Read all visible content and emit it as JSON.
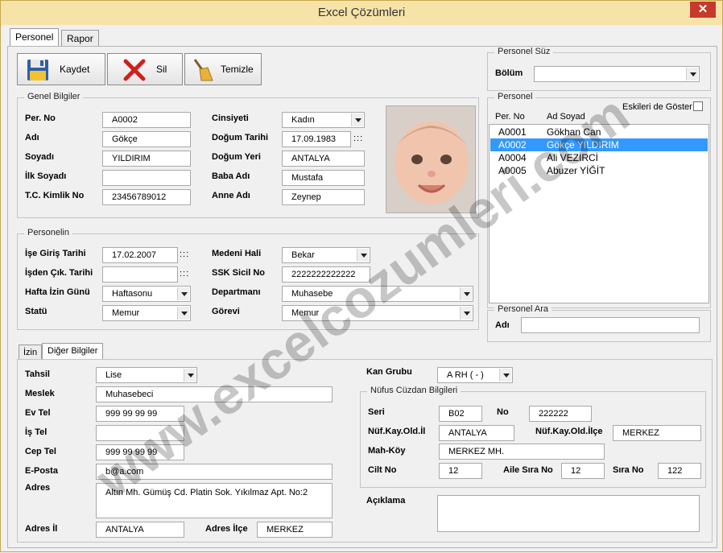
{
  "window": {
    "title": "Excel Çözümleri",
    "close_glyph": "✕"
  },
  "main_tabs": [
    {
      "label": "Personel"
    },
    {
      "label": "Rapor"
    }
  ],
  "toolbar": {
    "save_label": "Kaydet",
    "delete_label": "Sil",
    "clear_label": "Temizle"
  },
  "genel": {
    "legend": "Genel Bilgiler",
    "per_no": {
      "label": "Per. No",
      "value": "A0002"
    },
    "adi": {
      "label": "Adı",
      "value": "Gökçe"
    },
    "soyadi": {
      "label": "Soyadı",
      "value": "YILDIRIM"
    },
    "ilk_soyadi": {
      "label": "İlk Soyadı",
      "value": ""
    },
    "tc": {
      "label": "T.C. Kimlik No",
      "value": "23456789012"
    },
    "cinsiyet": {
      "label": "Cinsiyeti",
      "value": "Kadın"
    },
    "dogum_tarihi": {
      "label": "Doğum Tarihi",
      "value": "17.09.1983"
    },
    "dogum_yeri": {
      "label": "Doğum Yeri",
      "value": "ANTALYA"
    },
    "baba_adi": {
      "label": "Baba Adı",
      "value": "Mustafa"
    },
    "anne_adi": {
      "label": "Anne Adı",
      "value": "Zeynep"
    }
  },
  "personelin": {
    "legend": "Personelin",
    "ise_giris": {
      "label": "İşe Giriş Tarihi",
      "value": "17.02.2007"
    },
    "isden_cikis": {
      "label": "İşden Çık. Tarihi",
      "value": ""
    },
    "hafta_izin": {
      "label": "Hafta İzin Günü",
      "value": "Haftasonu"
    },
    "statu": {
      "label": "Statü",
      "value": "Memur"
    },
    "medeni_hali": {
      "label": "Medeni Hali",
      "value": "Bekar"
    },
    "ssk_sicil": {
      "label": "SSK Sicil  No",
      "value": "2222222222222"
    },
    "departman": {
      "label": "Departmanı",
      "value": "Muhasebe"
    },
    "gorevi": {
      "label": "Görevi",
      "value": "Memur"
    }
  },
  "date_dots": ":::",
  "filter": {
    "legend": "Personel Süz",
    "bolum_label": "Bölüm",
    "bolum_value": ""
  },
  "personel_list": {
    "legend": "Personel",
    "show_old_label": "Eskileri de Göster",
    "col_per_no": "Per. No",
    "col_ad_soyad": "Ad Soyad",
    "rows": [
      {
        "no": "A0001",
        "name": "Gökhan Can"
      },
      {
        "no": "A0002",
        "name": "Gökçe YILDIRIM"
      },
      {
        "no": "A0004",
        "name": "Ali VEZİRCİ"
      },
      {
        "no": "A0005",
        "name": "Abuzer YİĞİT"
      }
    ]
  },
  "search": {
    "legend": "Personel Ara",
    "label": "Adı",
    "value": ""
  },
  "sub_tabs": [
    {
      "label": "İzin"
    },
    {
      "label": "Diğer Bilgiler"
    }
  ],
  "diger": {
    "tahsil": {
      "label": "Tahsil",
      "value": "Lise"
    },
    "meslek": {
      "label": "Meslek",
      "value": "Muhasebeci"
    },
    "ev_tel": {
      "label": "Ev Tel",
      "value": "999 99 99 99"
    },
    "is_tel": {
      "label": "İş Tel",
      "value": ""
    },
    "cep_tel": {
      "label": "Cep Tel",
      "value": "999 99 99 99"
    },
    "eposta": {
      "label": "E-Posta",
      "value": "b@a.com"
    },
    "adres": {
      "label": "Adres",
      "value": "Altın Mh. Gümüş Cd. Platin Sok. Yıkılmaz Apt. No:2"
    },
    "adres_il": {
      "label": "Adres İl",
      "value": "ANTALYA"
    },
    "adres_ilce": {
      "label": "Adres İlçe",
      "value": "MERKEZ"
    },
    "kan_grubu": {
      "label": "Kan Grubu",
      "value": "A RH ( - )"
    },
    "aciklama": {
      "label": "Açıklama",
      "value": ""
    }
  },
  "nufus": {
    "legend": "Nüfus Cüzdan Bilgileri",
    "seri": {
      "label": "Seri",
      "value": "B02"
    },
    "no": {
      "label": "No",
      "value": "222222"
    },
    "kay_il": {
      "label": "Nüf.Kay.Old.İl",
      "value": "ANTALYA"
    },
    "kay_ilce": {
      "label": "Nüf.Kay.Old.İlçe",
      "value": "MERKEZ"
    },
    "mah_koy": {
      "label": "Mah-Köy",
      "value": "MERKEZ MH."
    },
    "cilt_no": {
      "label": "Cilt No",
      "value": "12"
    },
    "aile_sira": {
      "label": "Aile Sıra No",
      "value": "12"
    },
    "sira_no": {
      "label": "Sıra No",
      "value": "122"
    }
  },
  "watermark": {
    "text": "www.excelcozumleri.com"
  },
  "colors": {
    "title_bar": "#f6e3a8",
    "selection": "#3399ff",
    "accent_border": "#c7a64f"
  }
}
